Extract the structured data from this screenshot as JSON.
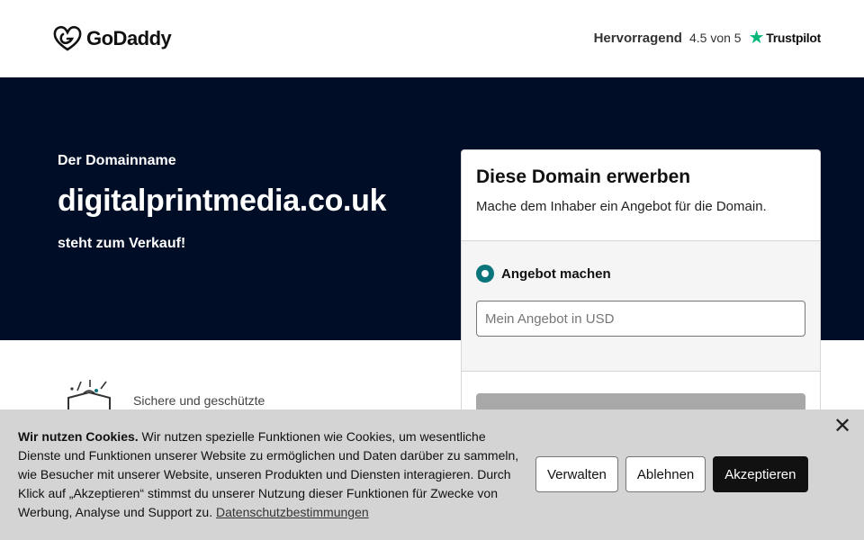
{
  "header": {
    "logo_text": "GoDaddy",
    "trust_rating": "Hervorragend",
    "trust_score": "4.5 von 5",
    "trust_brand": "Trustpilot"
  },
  "hero": {
    "pre": "Der Domainname",
    "domain": "digitalprintmedia.co.uk",
    "post": "steht zum Verkauf!"
  },
  "card": {
    "title": "Diese Domain erwerben",
    "subtitle": "Mache dem Inhaber ein Angebot für die Domain.",
    "option_label": "Angebot machen",
    "input_placeholder": "Mein Angebot in USD"
  },
  "feature": {
    "text": "Sichere und geschützte"
  },
  "cookie": {
    "title": "Wir nutzen Cookies.",
    "body": " Wir nutzen spezielle Funktionen wie Cookies, um wesentliche Dienste und Funktionen unserer Website zu ermöglichen und Daten darüber zu sammeln, wie Besucher mit unserer Website, unseren Produkten und Diensten interagieren. Durch Klick auf „Akzeptieren“ stimmst du unserer Nutzung dieser Funktionen für Zwecke von Werbung, Analyse und Support zu. ",
    "link": "Datenschutzbestimmungen",
    "manage": "Verwalten",
    "decline": "Ablehnen",
    "accept": "Akzeptieren"
  },
  "colors": {
    "hero_bg": "#000d26",
    "accent_teal": "#09757a",
    "trustpilot_green": "#00b67a"
  }
}
